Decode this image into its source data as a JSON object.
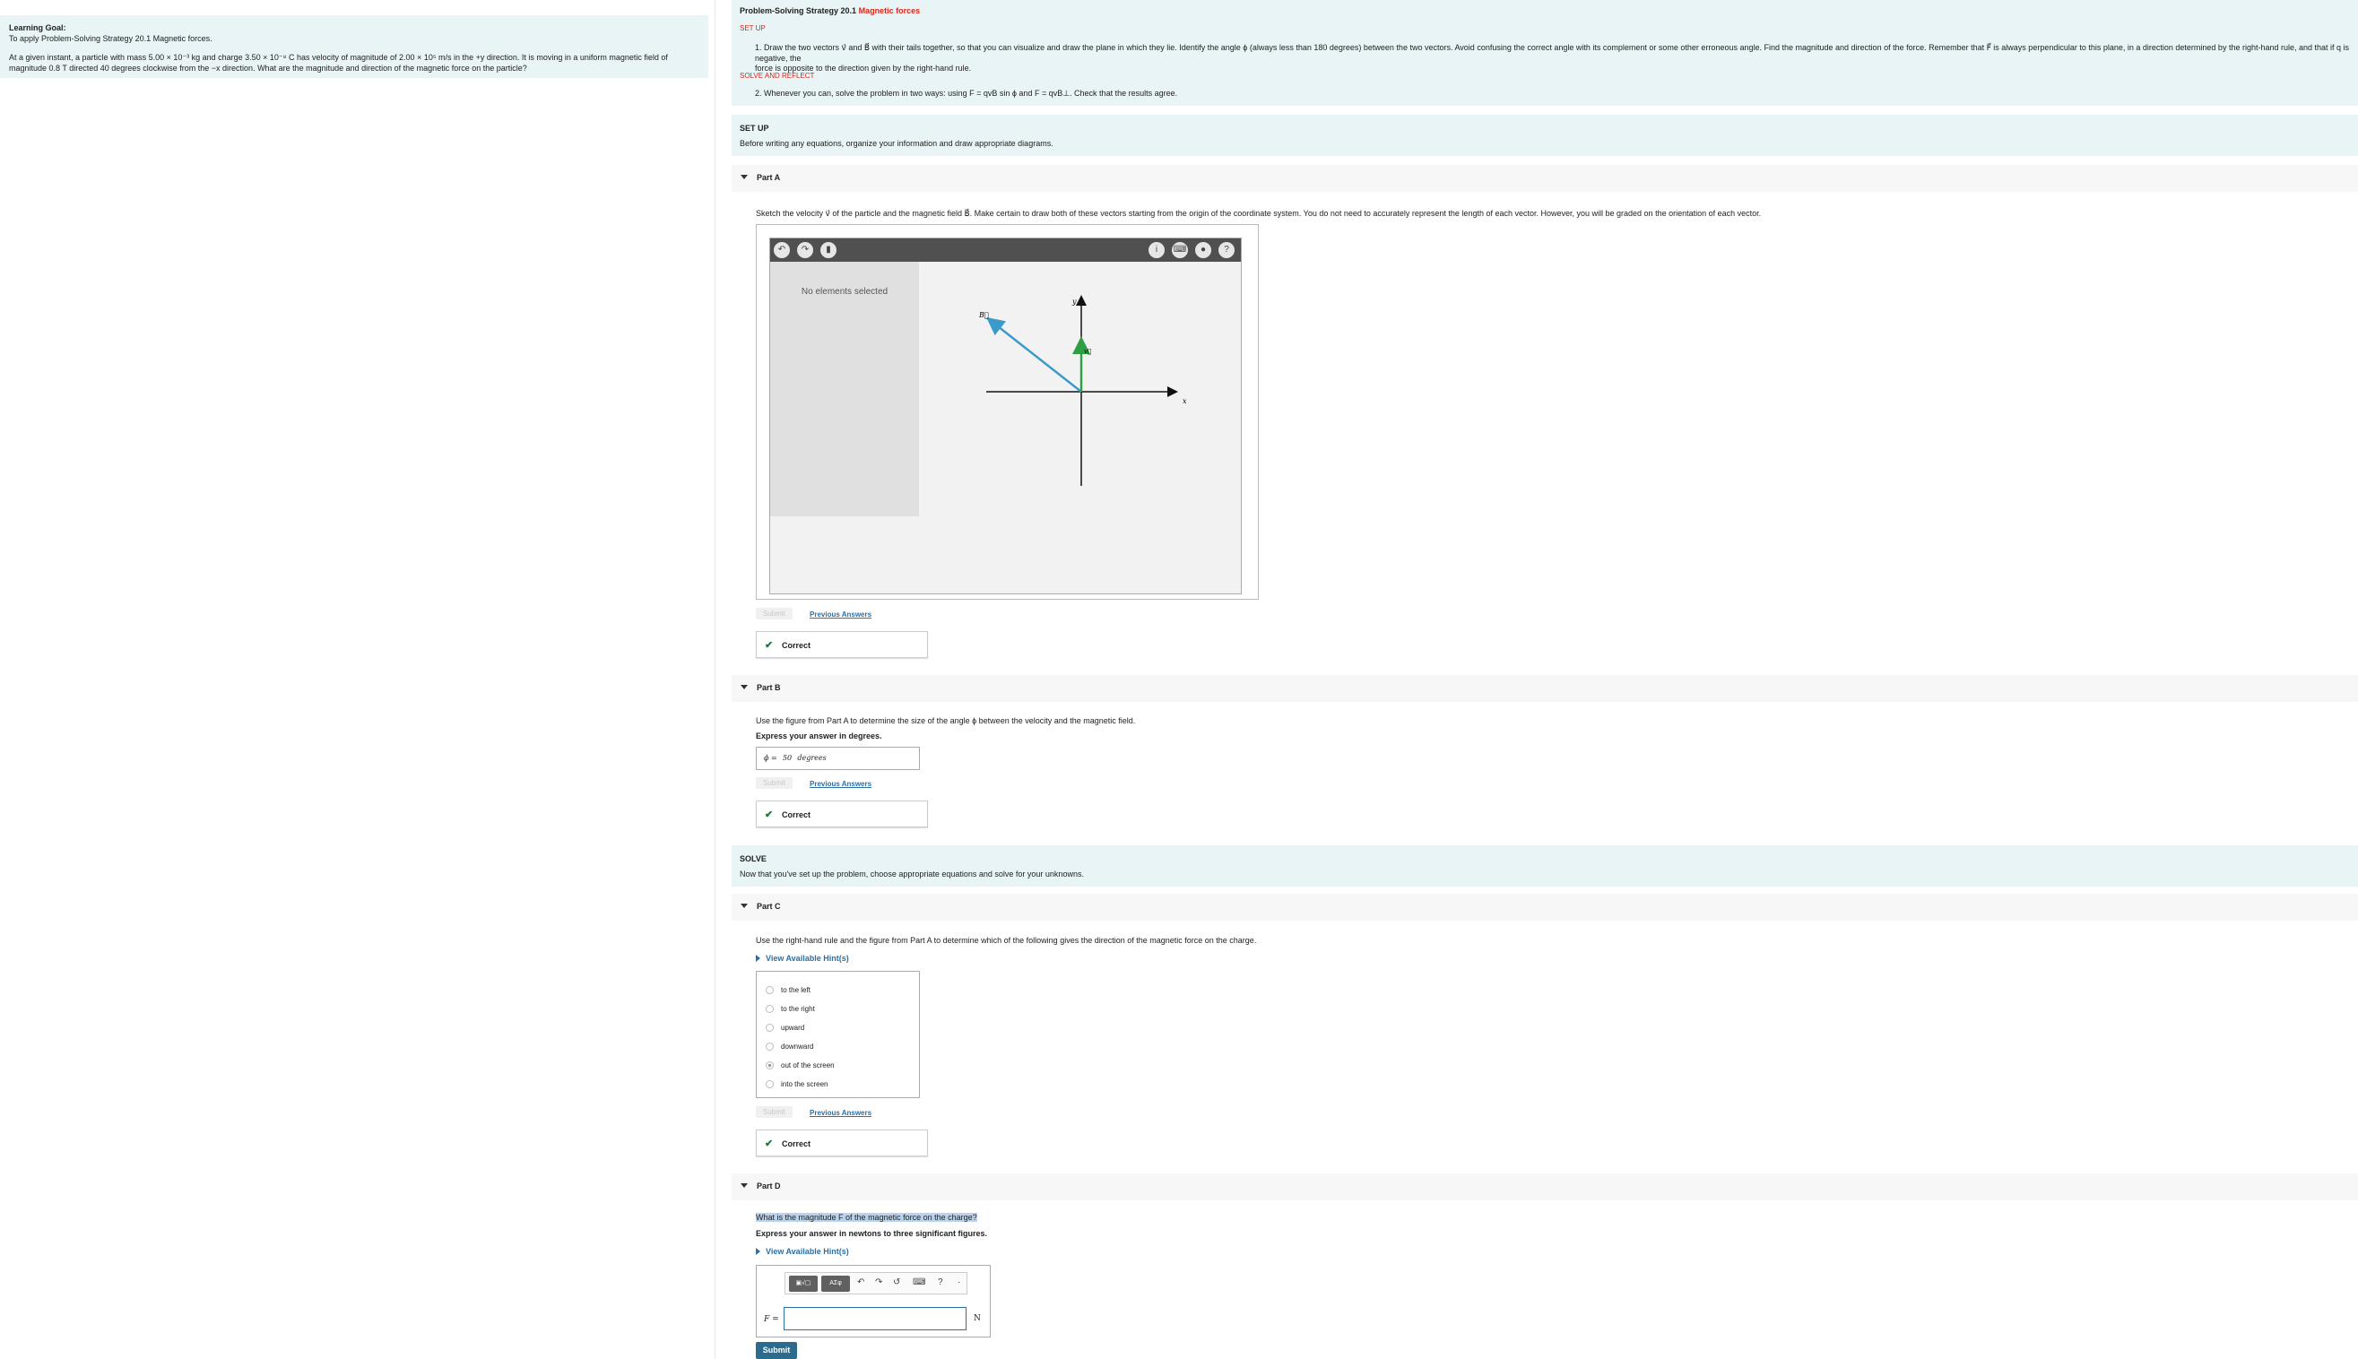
{
  "learning_goal": {
    "title": "Learning Goal:",
    "subtitle": "To apply Problem-Solving Strategy 20.1 Magnetic forces.",
    "problem_line1": "At a given instant, a particle with mass 5.00 × 10⁻³ kg and charge 3.50 × 10⁻⁸ C has velocity of magnitude of 2.00 × 10⁵ m/s in the +y direction. It is moving in a uniform magnetic field of",
    "problem_line2": "magnitude 0.8 T directed 40 degrees clockwise from the −x direction. What are the magnitude and direction of the magnetic force on the particle?"
  },
  "strategy": {
    "title_prefix": "Problem-Solving Strategy 20.1",
    "title_link": "Magnetic forces",
    "setup_label": "SET UP",
    "step1_line1": "1. Draw the two vectors v⃗ and B⃗ with their tails together, so that you can visualize and draw the plane in which they lie. Identify the angle ϕ (always less than 180 degrees) between the two vectors. Avoid confusing the correct angle with its complement or some other erroneous angle. Find the magnitude and direction of the force. Remember that F⃗ is always perpendicular to this plane, in a direction determined by the right-hand rule, and that if q is negative, the",
    "step1_line2": "force is opposite to the direction given by the right-hand rule.",
    "solve_label": "SOLVE AND REFLECT",
    "step2": "2. Whenever you can, solve the problem in two ways: using F = qvB sin ϕ and F = qvB⊥. Check that the results agree."
  },
  "setup_section": {
    "title": "SET UP",
    "text": "Before writing any equations, organize your information and draw appropriate diagrams."
  },
  "solve_section": {
    "title": "SOLVE",
    "text": "Now that you've set up the problem, choose appropriate equations and solve for your unknowns."
  },
  "part_a": {
    "label": "Part A",
    "prompt": "Sketch the velocity v⃗ of the particle and the magnetic field B⃗. Make certain to draw both of these vectors starting from the origin of the coordinate system. You do not need to accurately represent the length of each vector. However, you will be graded on the orientation of each vector.",
    "sidebar_text": "No elements selected",
    "axis_x": "x",
    "axis_y": "y",
    "vec_B": "B⃗",
    "vec_v": "v⃗",
    "submit": "Submit",
    "previous": "Previous Answers",
    "result": "Correct"
  },
  "part_b": {
    "label": "Part B",
    "prompt": "Use the figure from Part A to determine the size of the angle ϕ between the velocity and the magnetic field.",
    "instruction": "Express your answer in degrees.",
    "answer_label": "ϕ =",
    "answer_value": "50",
    "answer_unit": "degrees",
    "submit": "Submit",
    "previous": "Previous Answers",
    "result": "Correct"
  },
  "part_c": {
    "label": "Part C",
    "prompt": "Use the right-hand rule and the figure from Part A to determine which of the following gives the direction of the magnetic force on the charge.",
    "hint": "View Available Hint(s)",
    "options": [
      "to the left",
      "to the right",
      "upward",
      "downward",
      "out of the screen",
      "into the screen"
    ],
    "selected": "out of the screen",
    "submit": "Submit",
    "previous": "Previous Answers",
    "result": "Correct"
  },
  "part_d": {
    "label": "Part D",
    "prompt": "What is the magnitude F of the magnetic force on the charge?",
    "instruction": "Express your answer in newtons to three significant figures.",
    "hint": "View Available Hint(s)",
    "templates_label": "▣√▢",
    "symbols_label": "ΑΣφ",
    "input_label": "F =",
    "unit": "N",
    "submit": "Submit"
  },
  "colors": {
    "band": "#e8f4f6",
    "link": "#2a6fa5",
    "red": "#d9281c",
    "vector_B": "#3a9ac9",
    "vector_v": "#2ea043",
    "submit": "#2b6c8e"
  }
}
